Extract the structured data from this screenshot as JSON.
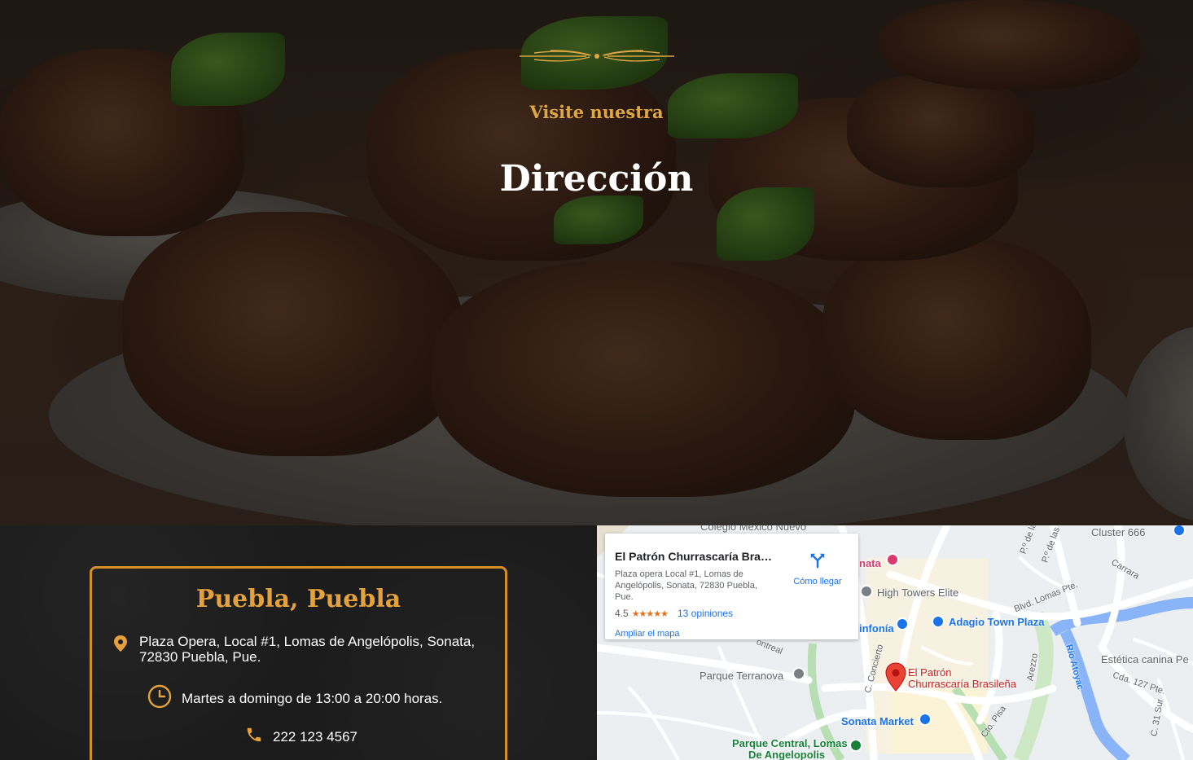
{
  "hero": {
    "kicker": "Visite nuestra",
    "title": "Dirección"
  },
  "location": {
    "city": "Puebla, Puebla",
    "address": "Plaza Opera, Local #1, Lomas de Angelópolis, Sonata, 72830 Puebla, Pue.",
    "hours": "Martes a domingo de 13:00 a 20:00 horas.",
    "phone": "222 123 4567"
  },
  "map_card": {
    "name": "El Patrón Churrascaría Brasile...",
    "address": "Plaza opera Local #1, Lomas de Angelópolis, Sonata, 72830 Puebla, Pue.",
    "rating": "4.5",
    "stars": "★★★★★",
    "reviews": "13 opiniones",
    "directions": "Cómo llegar",
    "enlarge": "Ampliar el mapa"
  },
  "map_labels": {
    "colegio": "Colegio México Nuevo",
    "cluster": "Cluster 666",
    "sonata_partial": "nata",
    "high_towers": "High Towers Elite",
    "sinfonia": "infonía",
    "adagio": "Adagio Town Plaza",
    "blvd": "Blvd. Lomas Pte.",
    "carrara": "Carrara",
    "monfreal": "ontreal",
    "concierto": "C. Concierto",
    "parque_terranova": "Parque Terranova",
    "el_patron_1": "El Patrón",
    "el_patron_2": "Churrascaría Brasileña",
    "arezzo": "Arezzo",
    "rio": "Río Atoyac",
    "estetica": "Estética canina Pe",
    "cda": "Cda. 127 Pte.",
    "sonata_market": "Sonata Market",
    "cto_pisa": "Cto. Pisa",
    "c31": "C. 31 Sur",
    "parque_central_1": "Parque Central, Lomas",
    "parque_central_2": "De Angelopolis",
    "p_de_la": "P.º de la",
    "p_de_las": "P.º de las"
  },
  "colors": {
    "accent_gold": "#e5a23a",
    "card_border": "#d68f24",
    "panel_bg": "#1b1b1b",
    "map_blue": "#1a73e8",
    "map_red_pin": "#ea4335"
  },
  "icons": {
    "address": "map-pin-icon",
    "hours": "clock-icon",
    "phone": "phone-icon",
    "directions": "directions-icon"
  }
}
